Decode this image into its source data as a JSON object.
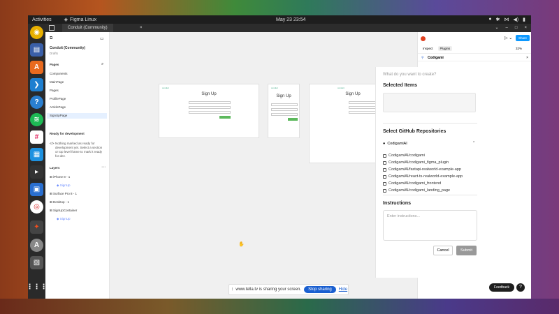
{
  "topbar": {
    "activities": "Activities",
    "app_name": "Figma Linux",
    "clock": "May 23  23:54"
  },
  "tabbar": {
    "tab_title": "Conduit (Community)",
    "close": "×"
  },
  "left": {
    "project": "Conduit (Community)",
    "drafts": "Drafts",
    "pages_header": "Pages",
    "pages": [
      "Components",
      "MainPage",
      "Pages",
      "ProfilePage",
      "ArticlePage",
      "SignUpPage"
    ],
    "active_page": "SignUpPage",
    "ready_header": "Ready for development",
    "ready_text": "Nothing marked as ready for development yet. Select a section or top level frame to mark it ready for dev.",
    "layers_header": "Layers",
    "layers": [
      {
        "name": "iPhone 8 - 1",
        "child": "SignUp"
      },
      {
        "name": "Surface Pro 8 - 1",
        "child": null
      },
      {
        "name": "Desktop - 1",
        "child": null
      },
      {
        "name": "SignUpContainer",
        "child": "SignUp"
      }
    ]
  },
  "canvas": {
    "frame_title": "Sign Up"
  },
  "share_bar": {
    "text": "www.tella.tv is sharing your screen.",
    "stop": "Stop sharing",
    "hide": "Hide"
  },
  "right_panel": {
    "share": "Share",
    "tab_inspect": "Inspect",
    "tab_plugins": "Plugins",
    "zoom": "32%",
    "plugin_name": "Codigami"
  },
  "plugin": {
    "prompt": "What do you want to create?",
    "selected_items": "Selected Items",
    "select_repos": "Select GitHub Repositories",
    "org": "CodigamiAI",
    "repos": [
      "CodigamiAI/codigami",
      "CodigamiAI/codigami_figma_plugin",
      "CodigamiAI/fastapi-realworld-example-app",
      "CodigamiAI/react-ts-realworld-example-app",
      "CodigamiAI/codigami_frontend",
      "CodigamiAI/codigami_landing_page"
    ],
    "instructions_header": "Instructions",
    "instructions_placeholder": "Enter instructions...",
    "cancel": "Cancel",
    "submit": "Submit"
  },
  "footer": {
    "feedback": "Feedback",
    "help": "?"
  }
}
